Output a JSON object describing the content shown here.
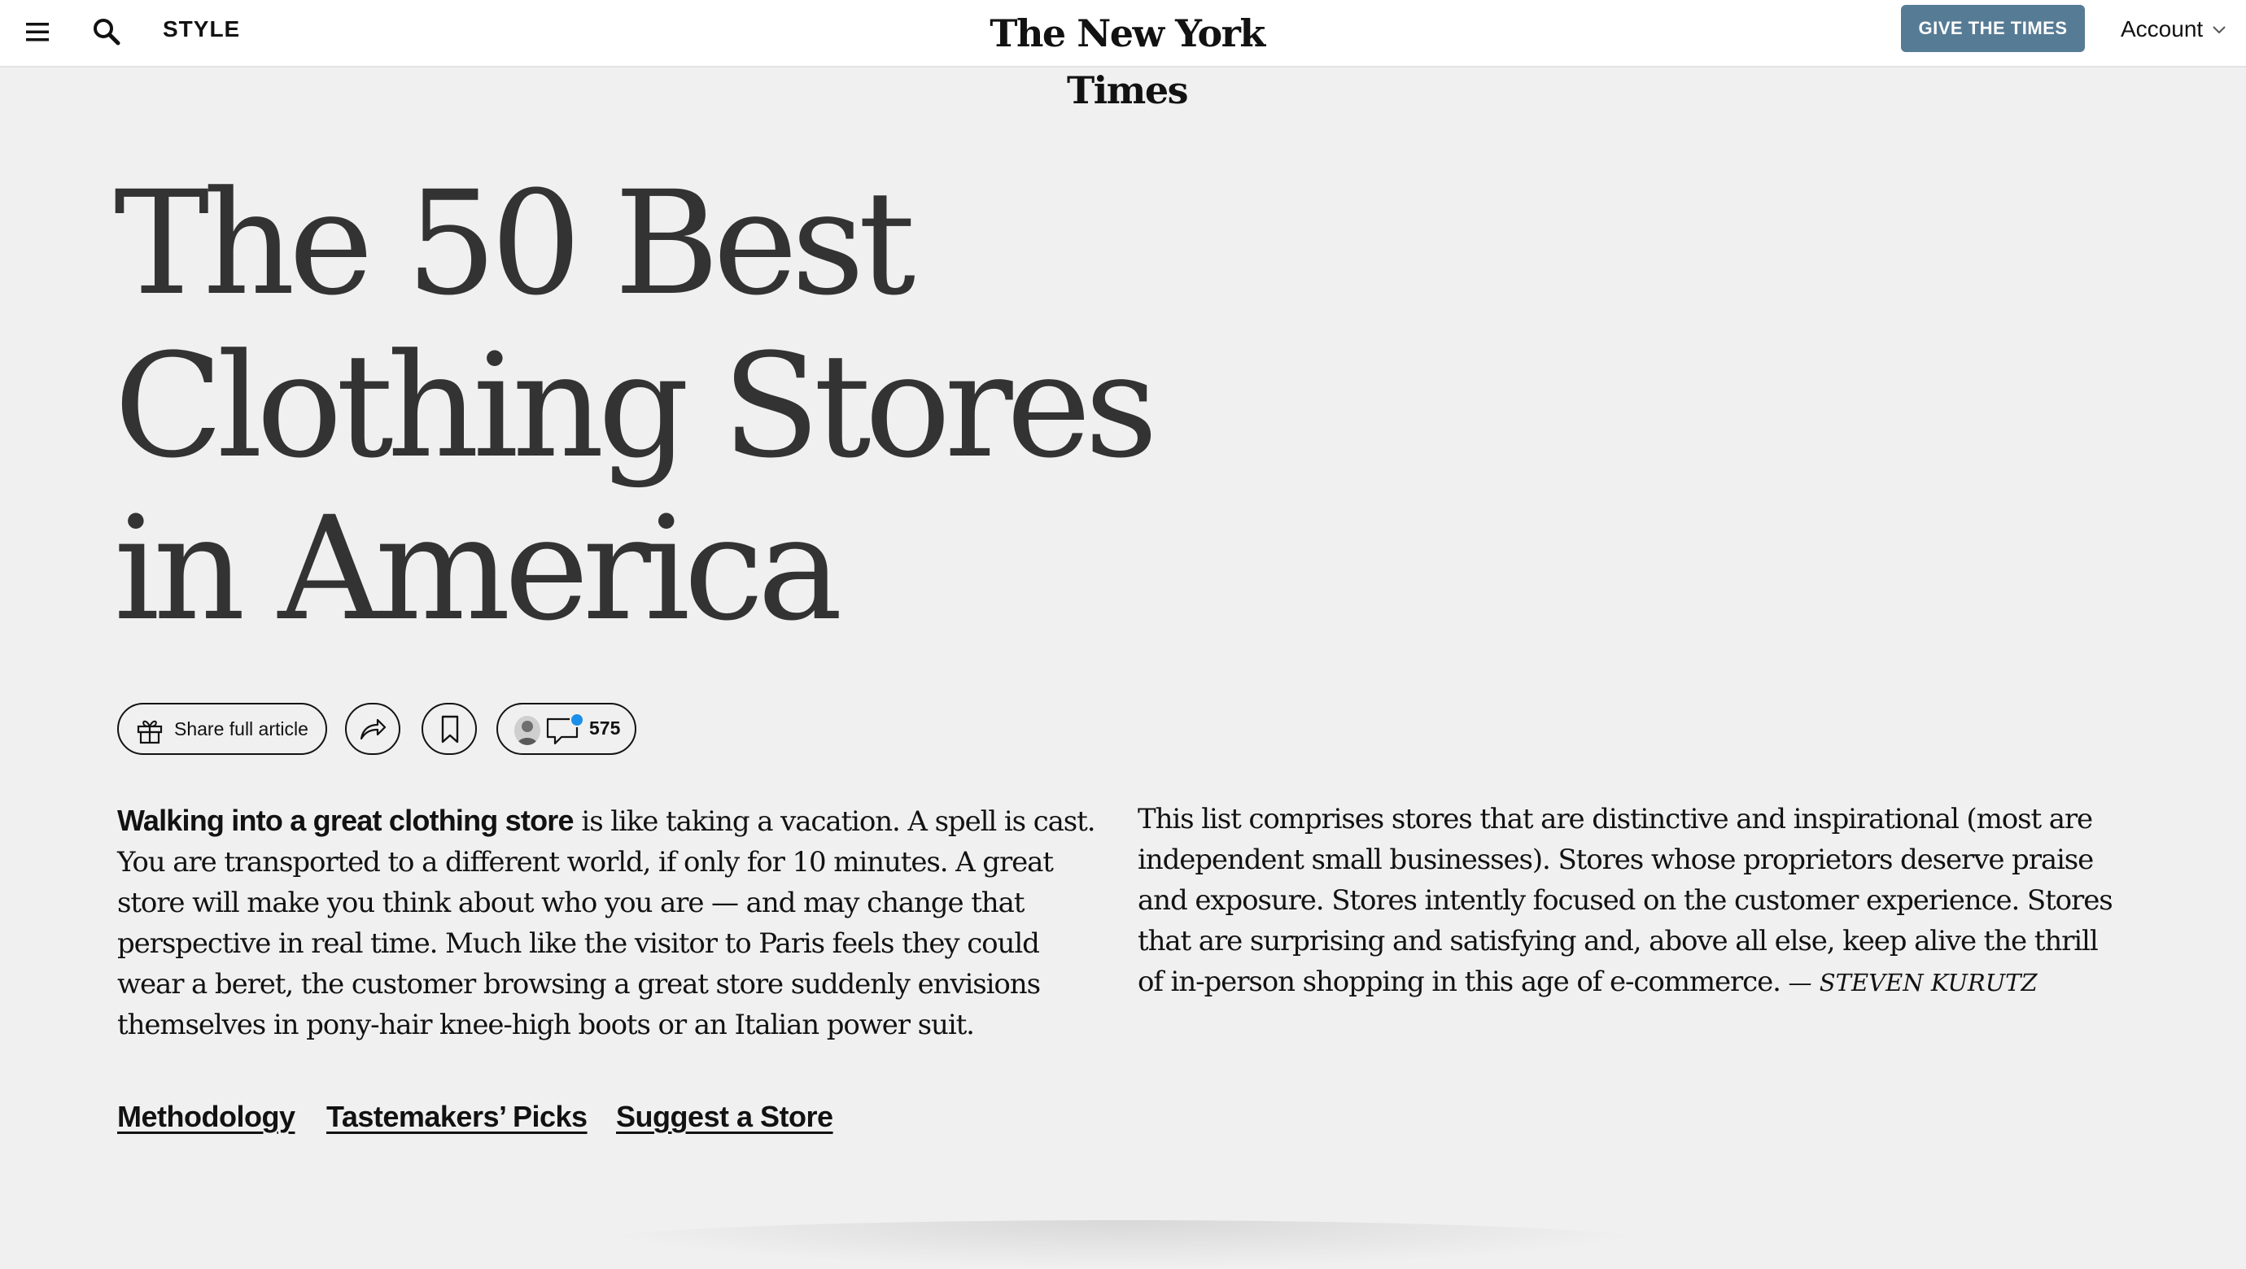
{
  "header": {
    "section": "STYLE",
    "masthead": "The New York Times",
    "give_button": "GIVE THE TIMES",
    "account": "Account"
  },
  "article": {
    "headline_lines": [
      "The 50 Best",
      "Clothing Stores",
      "in America"
    ],
    "toolbar": {
      "share_full_label": "Share full article",
      "comment_count": "575"
    },
    "left_column": {
      "lede": "Walking into a great clothing store",
      "text": " is like taking a vacation. A spell is cast. You are transported to a different world, if only for 10 minutes. A great store will make you think about who you are — and may change that perspective in real time. Much like the visitor to Paris feels they could wear a beret, the customer browsing a great store suddenly envisions themselves in pony-hair knee-high boots or an Italian power suit."
    },
    "right_column": {
      "text": "This list comprises stores that are distinctive and inspirational (most are independent small businesses). Stores whose proprietors deserve praise and exposure. Stores intently focused on the customer experience. Stores that are surprising and satisfying and, above all else, keep alive the thrill of in-person shopping in this age of e-commerce. ",
      "byline": "— STEVEN KURUTZ"
    },
    "links": [
      "Methodology",
      "Tastemakers’ Picks",
      "Suggest a Store"
    ]
  },
  "colors": {
    "page_background": "#f0f0f0",
    "header_background": "#ffffff",
    "give_button_background": "#567b95",
    "text": "#121212",
    "headline_text": "#333333",
    "notification_dot": "#1a8ee8"
  },
  "icons": [
    "menu-icon",
    "search-icon",
    "chevron-down-icon",
    "gift-icon",
    "share-arrow-icon",
    "bookmark-icon",
    "comment-icon"
  ]
}
